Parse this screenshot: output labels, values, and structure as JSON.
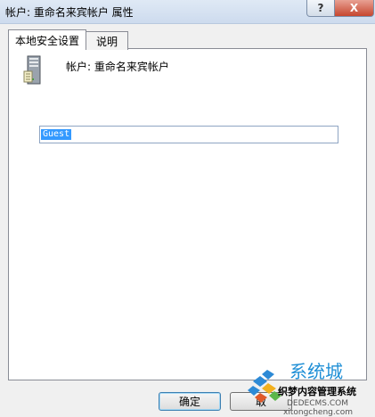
{
  "window": {
    "title": "帐户: 重命名来宾帐户 属性",
    "help_label": "?",
    "close_label": "X"
  },
  "tabs": [
    {
      "label": "本地安全设置"
    },
    {
      "label": "说明"
    }
  ],
  "content": {
    "account_label": "帐户: 重命名来宾帐户",
    "account_name_value": "Guest"
  },
  "buttons": {
    "ok_label": "确定",
    "cancel_label": "取"
  },
  "watermark": {
    "text1": "系统城",
    "text2": "织梦内容管理系统",
    "text3": "DEDECMS.COM",
    "text4": "xitongcheng.com"
  },
  "colors": {
    "selection": "#3399ff",
    "close_button": "#c6472f",
    "watermark_blue": "#1f8fd6"
  },
  "icons": [
    "server-icon",
    "windows-logo-icon"
  ]
}
